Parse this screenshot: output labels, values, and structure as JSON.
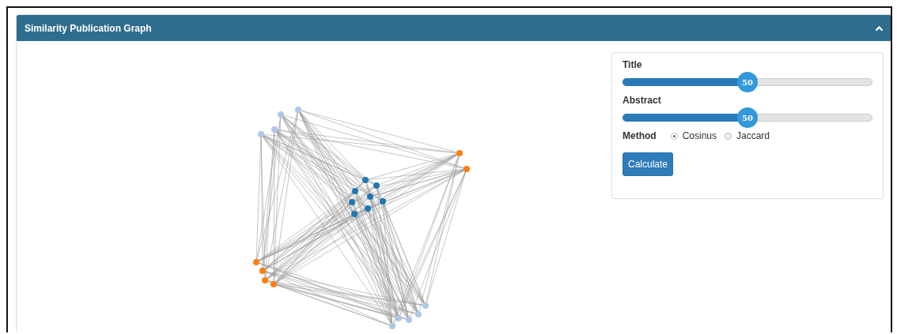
{
  "panel": {
    "title": "Similarity Publication Graph",
    "expanded": true
  },
  "controls": {
    "sliders": [
      {
        "label": "Title",
        "level": 0.5,
        "reading": "50"
      },
      {
        "label": "Abstract",
        "level": 0.5,
        "reading": "50"
      }
    ],
    "method": {
      "label": "Method",
      "options": [
        {
          "label": "Cosinus",
          "selected": true
        },
        {
          "label": "Jaccard",
          "selected": false
        }
      ]
    },
    "button": "Calculate"
  }
}
